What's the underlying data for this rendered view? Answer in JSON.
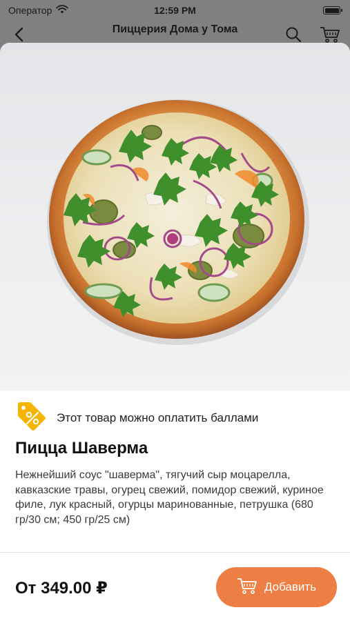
{
  "status_bar": {
    "carrier": "Оператор",
    "time": "12:59 PM"
  },
  "nav": {
    "title": "Пиццерия Дома у Тома"
  },
  "product": {
    "points_notice": "Этот товар можно оплатить баллами",
    "name": "Пицца Шаверма",
    "description": "Нежнейший соус  \"шаверма\", тягучий сыр моцарелла, кавказские травы, огурец свежий, помидор свежий, куриное филе, лук красный, огурцы маринованные, петрушка (680 гр/30 см; 450 гр/25 см)",
    "price": "От 349.00 ₽",
    "add_label": "Добавить"
  },
  "icons": {
    "back": "chevron-left-icon",
    "search": "search-icon",
    "cart": "cart-icon",
    "points_tag": "discount-tag-icon",
    "wifi": "wifi-icon",
    "battery": "battery-icon"
  },
  "colors": {
    "accent": "#ed7f45",
    "tag": "#f5b400",
    "text": "#1d1d1f",
    "secondary_text": "#3a3a3c"
  }
}
